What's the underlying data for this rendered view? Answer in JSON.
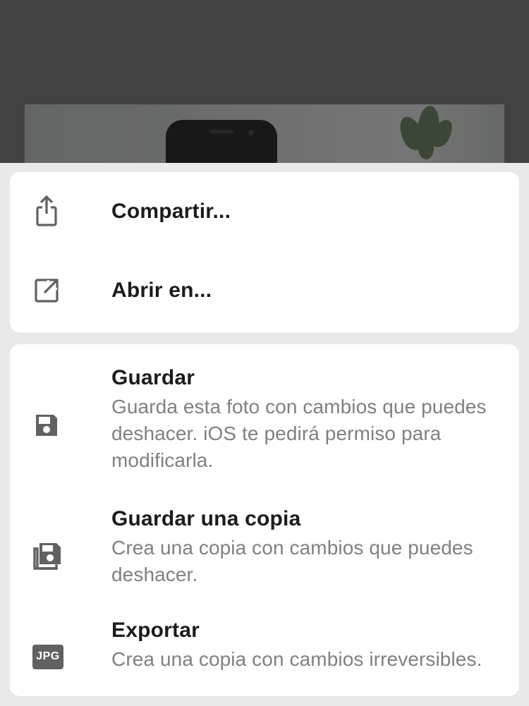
{
  "menu": {
    "group1": [
      {
        "label": "Compartir...",
        "icon": "share-icon"
      },
      {
        "label": "Abrir en...",
        "icon": "open-in-icon"
      }
    ],
    "group2": [
      {
        "title": "Guardar",
        "subtitle": "Guarda esta foto con cambios que puedes deshacer. iOS te pedirá permiso para modificarla.",
        "icon": "save-icon"
      },
      {
        "title": "Guardar una copia",
        "subtitle": "Crea una copia con cambios que puedes deshacer.",
        "icon": "save-copy-icon"
      },
      {
        "title": "Exportar",
        "subtitle": "Crea una copia con cambios irreversibles.",
        "icon": "jpg-badge-icon",
        "badge_text": "JPG"
      }
    ]
  }
}
